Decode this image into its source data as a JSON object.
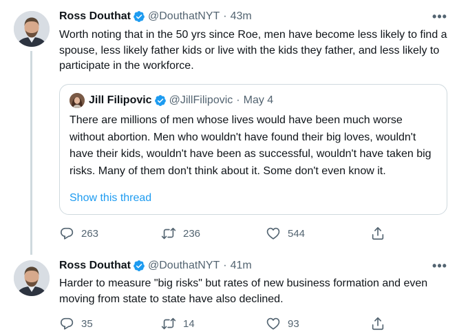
{
  "tweet1": {
    "name": "Ross Douthat",
    "handle": "@DouthatNYT",
    "separator": "·",
    "time": "43m",
    "more": "•••",
    "text": "Worth noting that in the 50 yrs since Roe, men have become less likely to find a spouse, less likely father kids or live with the kids they father, and less likely to participate in the workforce.",
    "quote": {
      "name": "Jill Filipovic",
      "handle": "@JillFilipovic",
      "separator": "·",
      "time": "May 4",
      "text": "There are millions of men whose lives would have been much worse without abortion. Men who wouldn't have found their big loves, wouldn't have their kids, wouldn't have been as successful, wouldn't have taken big risks. Many of them don't think about it. Some don't even know it.",
      "show_thread": "Show this thread"
    },
    "replies": "263",
    "retweets": "236",
    "likes": "544"
  },
  "tweet2": {
    "name": "Ross Douthat",
    "handle": "@DouthatNYT",
    "separator": "·",
    "time": "41m",
    "more": "•••",
    "text": "Harder to measure \"big risks\" but rates of new business formation and even moving from state to state have also declined.",
    "replies": "35",
    "retweets": "14",
    "likes": "93"
  },
  "icons": {
    "verified": "verified-badge-icon",
    "reply": "reply-icon",
    "retweet": "retweet-icon",
    "like": "heart-icon",
    "share": "share-icon"
  },
  "colors": {
    "accent": "#1d9bf0",
    "secondary_text": "#536471",
    "border": "#cfd9de"
  }
}
